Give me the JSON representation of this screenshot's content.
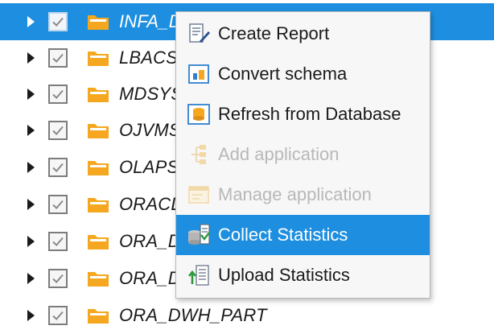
{
  "tree": {
    "rows": [
      {
        "label": "INFA_D",
        "selected": true
      },
      {
        "label": "LBACS",
        "selected": false
      },
      {
        "label": "MDSYS",
        "selected": false
      },
      {
        "label": "OJVMS",
        "selected": false
      },
      {
        "label": "OLAPS",
        "selected": false
      },
      {
        "label": "ORACL",
        "selected": false
      },
      {
        "label": "ORA_D",
        "selected": false
      },
      {
        "label": "ORA_D",
        "selected": false
      },
      {
        "label": "ORA_DWH_PART",
        "selected": false
      }
    ]
  },
  "context_menu": {
    "items": [
      {
        "label": "Create Report",
        "icon": "report-icon",
        "disabled": false,
        "highlighted": false
      },
      {
        "label": "Convert schema",
        "icon": "convert-schema-icon",
        "disabled": false,
        "highlighted": false
      },
      {
        "label": "Refresh from Database",
        "icon": "database-refresh-icon",
        "disabled": false,
        "highlighted": false
      },
      {
        "label": "Add application",
        "icon": "add-application-icon",
        "disabled": true,
        "highlighted": false
      },
      {
        "label": "Manage application",
        "icon": "manage-application-icon",
        "disabled": true,
        "highlighted": false
      },
      {
        "label": "Collect Statistics",
        "icon": "collect-statistics-icon",
        "disabled": false,
        "highlighted": true
      },
      {
        "label": "Upload Statistics",
        "icon": "upload-statistics-icon",
        "disabled": false,
        "highlighted": false
      }
    ]
  },
  "colors": {
    "selection": "#1e8fe0",
    "folder": "#f5a81f",
    "disabled_text": "#b8b8b8"
  }
}
